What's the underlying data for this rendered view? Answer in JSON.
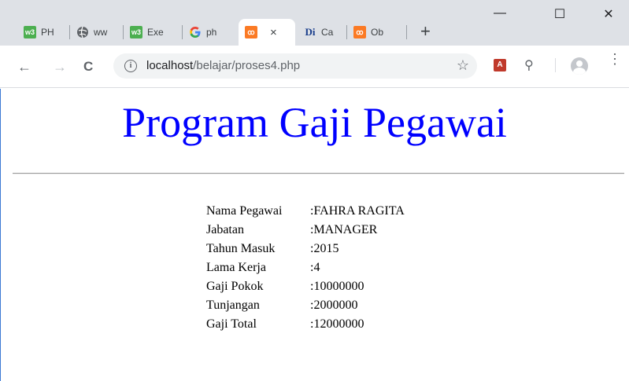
{
  "browser": {
    "tabs": [
      {
        "title": "PH",
        "favicon": "w3schools-icon",
        "active": false
      },
      {
        "title": "ww",
        "favicon": "globe-icon",
        "active": false
      },
      {
        "title": "Exe",
        "favicon": "w3schools-icon",
        "active": false
      },
      {
        "title": "ph",
        "favicon": "google-icon",
        "active": false
      },
      {
        "title": "",
        "favicon": "xampp-icon",
        "active": true
      },
      {
        "title": "Ca",
        "favicon": "dictionary-icon",
        "active": false
      },
      {
        "title": "Ob",
        "favicon": "xampp-icon",
        "active": false
      }
    ],
    "active_tab_close": "×",
    "new_tab": "+",
    "window_buttons": {
      "minimize": "—",
      "maximize": "☐",
      "close": "✕"
    },
    "nav": {
      "back": "←",
      "forward": "→",
      "reload": "C"
    },
    "address": {
      "host": "localhost",
      "path": "/belajar/proses4.php"
    },
    "icons": {
      "info": "i",
      "star": "☆",
      "pdf": "A",
      "search": "⚲",
      "menu": "⋮"
    }
  },
  "page": {
    "title": "Program Gaji Pegawai",
    "fields": [
      {
        "label": "Nama Pegawai",
        "value": ":FAHRA RAGITA"
      },
      {
        "label": "Jabatan",
        "value": ":MANAGER"
      },
      {
        "label": "Tahun Masuk",
        "value": ":2015"
      },
      {
        "label": "Lama Kerja",
        "value": ":4"
      },
      {
        "label": "Gaji Pokok",
        "value": ":10000000"
      },
      {
        "label": "Tunjangan",
        "value": ":2000000"
      },
      {
        "label": "Gaji Total",
        "value": ":12000000"
      }
    ]
  },
  "colors": {
    "title": "#0000ff",
    "tabstrip": "#dee1e6",
    "omnibox": "#f1f3f4"
  }
}
